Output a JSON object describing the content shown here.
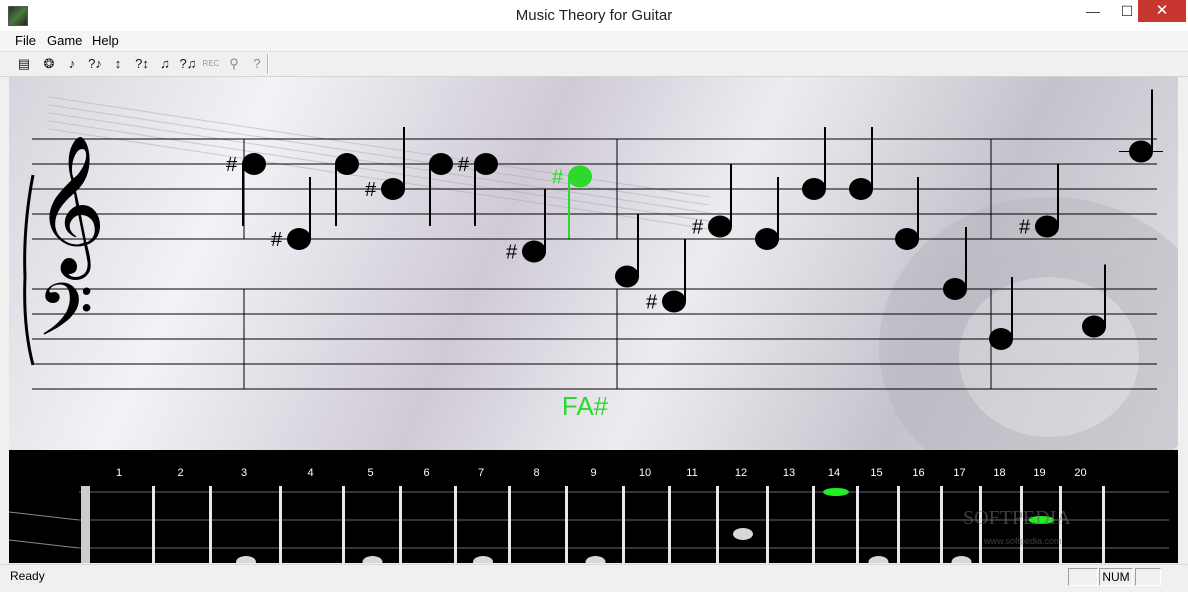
{
  "window": {
    "title": "Music Theory for Guitar",
    "minimize": "—",
    "maximize": "☐",
    "close": "✕"
  },
  "menu": [
    "File",
    "Game",
    "Help"
  ],
  "toolbar": [
    {
      "name": "sheet-icon",
      "glyph": "▤"
    },
    {
      "name": "ear-icon",
      "glyph": "❂"
    },
    {
      "name": "note-icon",
      "glyph": "♪"
    },
    {
      "name": "question-note-icon",
      "glyph": "?♪"
    },
    {
      "name": "up-down-icon",
      "glyph": "↕"
    },
    {
      "name": "question-up-down-icon",
      "glyph": "?↕"
    },
    {
      "name": "interval-icon",
      "glyph": "♫"
    },
    {
      "name": "question-interval-icon",
      "glyph": "?♫"
    },
    {
      "name": "record-icon",
      "glyph": "REC"
    },
    {
      "name": "guitar-icon",
      "glyph": "⚲"
    },
    {
      "name": "help-icon",
      "glyph": "?"
    }
  ],
  "staff": {
    "current_note_label": "FA#",
    "sharp": "#",
    "colors": {
      "note": "#000000",
      "active": "#2cd92c"
    },
    "clefs": [
      "treble",
      "bass"
    ],
    "notes": [
      {
        "staff_step": 8,
        "stem": "down",
        "sharp": true,
        "active": false
      },
      {
        "staff_step": 2,
        "stem": "up",
        "sharp": true,
        "active": false
      },
      {
        "staff_step": 8,
        "stem": "down",
        "sharp": false,
        "active": false
      },
      {
        "staff_step": 6,
        "stem": "up",
        "sharp": true,
        "active": false
      },
      {
        "staff_step": 8,
        "stem": "down",
        "sharp": false,
        "active": false
      },
      {
        "staff_step": 8,
        "stem": "down",
        "sharp": true,
        "active": false
      },
      {
        "staff_step": 1,
        "stem": "up",
        "sharp": true,
        "active": false
      },
      {
        "staff_step": 7,
        "stem": "down",
        "sharp": true,
        "active": true
      },
      {
        "staff_step": -1,
        "stem": "up",
        "sharp": false,
        "active": false
      },
      {
        "staff_step": -3,
        "stem": "up",
        "sharp": true,
        "active": false
      },
      {
        "staff_step": 3,
        "stem": "up",
        "sharp": true,
        "active": false
      },
      {
        "staff_step": 2,
        "stem": "up",
        "sharp": false,
        "active": false
      },
      {
        "staff_step": 6,
        "stem": "up",
        "sharp": false,
        "active": false
      },
      {
        "staff_step": 6,
        "stem": "up",
        "sharp": false,
        "active": false
      },
      {
        "staff_step": 2,
        "stem": "up",
        "sharp": false,
        "active": false
      },
      {
        "staff_step": -2,
        "stem": "up",
        "sharp": false,
        "active": false
      },
      {
        "staff_step": 3,
        "stem": "up",
        "sharp": true,
        "active": false
      },
      {
        "staff_step": -6,
        "stem": "up",
        "sharp": false,
        "active": false
      },
      {
        "staff_step": -5,
        "stem": "up",
        "sharp": false,
        "active": false
      },
      {
        "staff_step": 9,
        "stem": "up",
        "sharp": false,
        "active": false
      }
    ]
  },
  "fretboard": {
    "fret_numbers": [
      "1",
      "2",
      "3",
      "4",
      "5",
      "6",
      "7",
      "8",
      "9",
      "10",
      "11",
      "12",
      "13",
      "14",
      "15",
      "16",
      "17",
      "18",
      "19",
      "20"
    ],
    "inlay_frets": [
      3,
      5,
      7,
      9,
      12,
      15,
      17
    ],
    "highlight_color": "#22ee22",
    "highlights": [
      {
        "fret": 14,
        "string": 1
      },
      {
        "fret": 19,
        "string": 2
      }
    ],
    "watermark": "SOFTPEDIA",
    "watermark_url": "www.softpedia.com"
  },
  "status": {
    "text": "Ready",
    "num": "NUM"
  }
}
